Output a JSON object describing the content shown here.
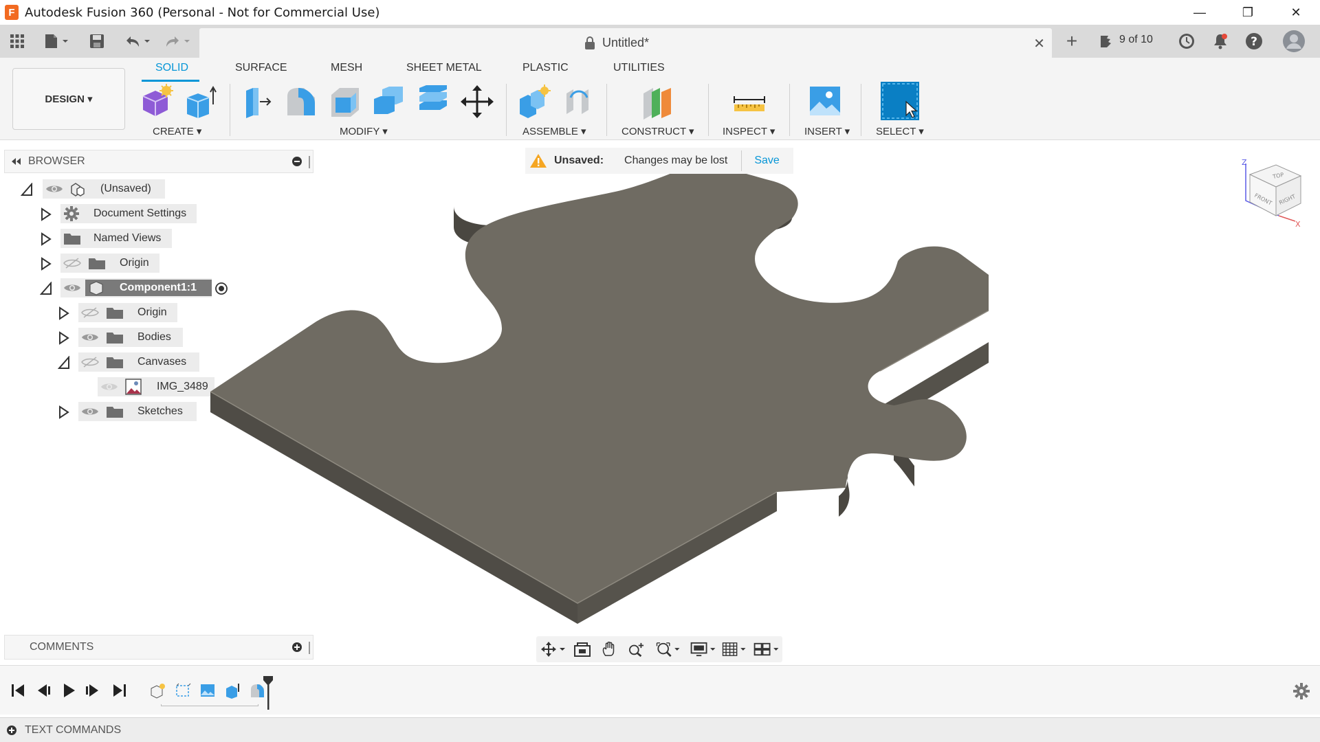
{
  "window": {
    "title": "Autodesk Fusion 360 (Personal - Not for Commercial Use)",
    "app_icon_letter": "F",
    "controls": {
      "minimize": "—",
      "restore": "❐",
      "close": "✕"
    }
  },
  "quick_access": {
    "document_title": "Untitled*",
    "tab_close": "✕",
    "new_tab": "+",
    "tab_count": "9 of 10"
  },
  "ribbon": {
    "workspace": "DESIGN ▾",
    "tabs": [
      {
        "label": "SOLID",
        "active": true
      },
      {
        "label": "SURFACE"
      },
      {
        "label": "MESH"
      },
      {
        "label": "SHEET METAL"
      },
      {
        "label": "PLASTIC"
      },
      {
        "label": "UTILITIES"
      }
    ],
    "groups": {
      "create": "CREATE ▾",
      "modify": "MODIFY ▾",
      "assemble": "ASSEMBLE ▾",
      "construct": "CONSTRUCT ▾",
      "inspect": "INSPECT ▾",
      "insert": "INSERT ▾",
      "select": "SELECT ▾"
    }
  },
  "browser": {
    "title": "BROWSER",
    "root": "(Unsaved)",
    "items": [
      {
        "label": "Document Settings"
      },
      {
        "label": "Named Views"
      },
      {
        "label": "Origin"
      },
      {
        "label": "Component1:1"
      },
      {
        "label": "Origin"
      },
      {
        "label": "Bodies"
      },
      {
        "label": "Canvases"
      },
      {
        "label": "IMG_3489"
      },
      {
        "label": "Sketches"
      }
    ]
  },
  "notice": {
    "label": "Unsaved:",
    "message": "Changes may be lost",
    "action": "Save"
  },
  "viewcube": {
    "z": "Z",
    "x": "X",
    "top": "TOP",
    "front": "FRONT",
    "right": "RIGHT"
  },
  "comments": {
    "title": "COMMENTS"
  },
  "text_commands": {
    "title": "TEXT COMMANDS"
  },
  "colors": {
    "accent": "#0696d7",
    "model_top": "#6f6b62",
    "model_side": "#4f4c46"
  }
}
